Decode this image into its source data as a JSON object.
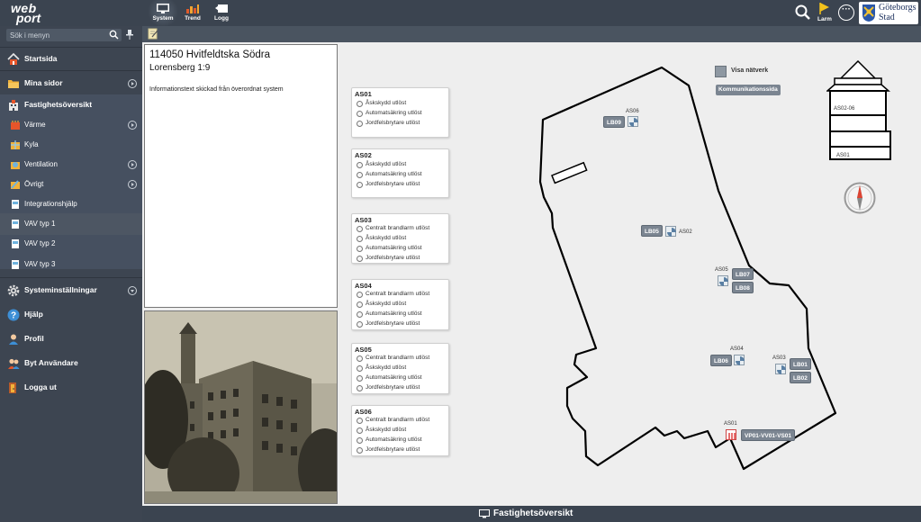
{
  "app": {
    "logo_line1": "web",
    "logo_line2": "port"
  },
  "topnav": {
    "system": "System",
    "trend": "Trend",
    "logg": "Logg",
    "larm": "Larm"
  },
  "city_logo": {
    "line1": "Göteborgs",
    "line2": "Stad"
  },
  "sidebar": {
    "search_placeholder": "Sök i menyn",
    "items": [
      {
        "label": "Startsida",
        "icon": "home-icon"
      },
      {
        "label": "Mina sidor",
        "icon": "folder-icon"
      },
      {
        "label": "Fastighetsöversikt",
        "icon": "building-icon"
      },
      {
        "label": "Värme",
        "icon": "heat-icon"
      },
      {
        "label": "Kyla",
        "icon": "snowflake-icon"
      },
      {
        "label": "Ventilation",
        "icon": "ventilation-icon"
      },
      {
        "label": "Övrigt",
        "icon": "wrench-icon"
      },
      {
        "label": "Integrationshjälp",
        "icon": "document-icon"
      },
      {
        "label": "VAV typ 1",
        "icon": "document-icon"
      },
      {
        "label": "VAV typ 2",
        "icon": "document-icon"
      },
      {
        "label": "VAV typ 3",
        "icon": "document-icon"
      },
      {
        "label": "Systeminställningar",
        "icon": "gear-icon"
      },
      {
        "label": "Hjälp",
        "icon": "help-icon"
      },
      {
        "label": "Profil",
        "icon": "user-icon"
      },
      {
        "label": "Byt Användare",
        "icon": "users-icon"
      },
      {
        "label": "Logga ut",
        "icon": "logout-icon"
      }
    ]
  },
  "info": {
    "title": "114050 Hvitfeldtska Södra",
    "subtitle": "Lorensberg 1:9",
    "text": "Informationstext skickad från överordnat system"
  },
  "as_cards": [
    {
      "title": "AS01",
      "rows": [
        "Åskskydd utlöst",
        "Automatsäkring utlöst",
        "Jordfelsbrytare utlöst"
      ]
    },
    {
      "title": "AS02",
      "rows": [
        "Åskskydd utlöst",
        "Automatsäkring utlöst",
        "Jordfelsbrytare utlöst"
      ]
    },
    {
      "title": "AS03",
      "rows": [
        "Centralt brandlarm utlöst",
        "Åskskydd utlöst",
        "Automatsäkring utlöst",
        "Jordfelsbrytare utlöst"
      ]
    },
    {
      "title": "AS04",
      "rows": [
        "Centralt brandlarm utlöst",
        "Åskskydd utlöst",
        "Automatsäkring utlöst",
        "Jordfelsbrytare utlöst"
      ]
    },
    {
      "title": "AS05",
      "rows": [
        "Centralt brandlarm utlöst",
        "Åskskydd utlöst",
        "Automatsäkring utlöst",
        "Jordfelsbrytare utlöst"
      ]
    },
    {
      "title": "AS06",
      "rows": [
        "Centralt brandlarm utlöst",
        "Åskskydd utlöst",
        "Automatsäkring utlöst",
        "Jordfelsbrytare utlöst"
      ]
    }
  ],
  "map": {
    "visa_natverk": "Visa nätverk",
    "kommunikation": "Kommunikationssida",
    "tower_labels": [
      "AS02-06",
      "AS01"
    ],
    "as_labels": {
      "as06": "AS06",
      "as02": "AS02",
      "as05": "AS05",
      "as04": "AS04",
      "as03": "AS03",
      "as01": "AS01"
    },
    "tags": {
      "lb09": "LB09",
      "lb05": "LB05",
      "lb07": "LB07",
      "lb08": "LB08",
      "lb06": "LB06",
      "lb01": "LB01",
      "lb02": "LB02",
      "vp": "VP01-VV01-VS01"
    }
  },
  "footer": {
    "title": "Fastighetsöversikt"
  }
}
